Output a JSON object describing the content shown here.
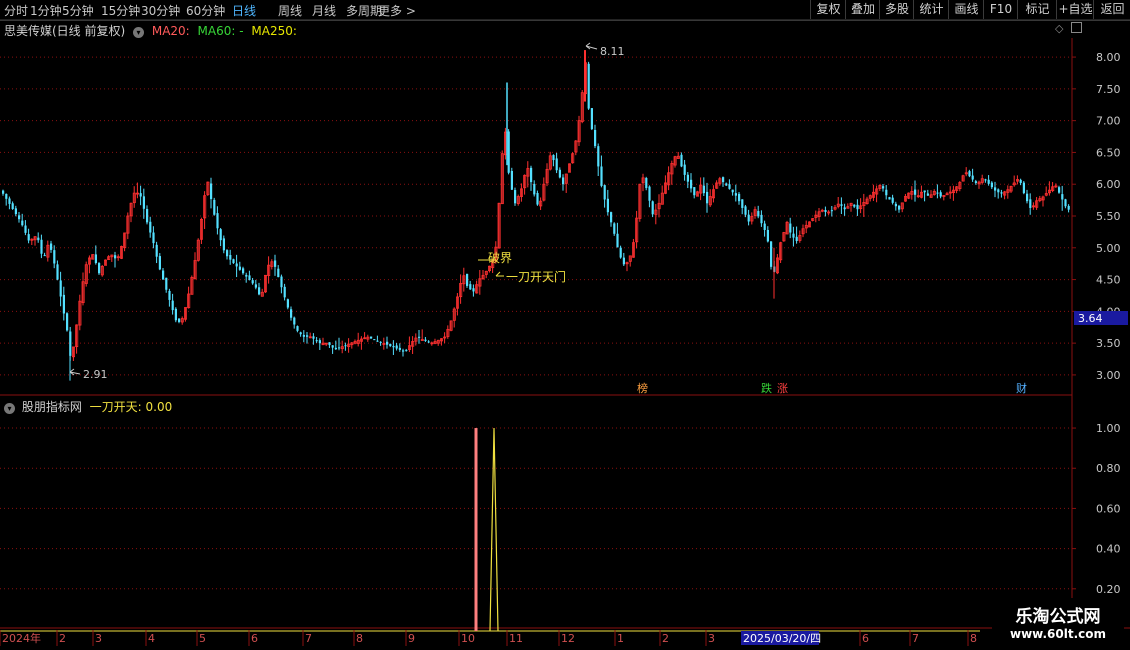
{
  "toolbar": {
    "periods": [
      "分时",
      "1分钟",
      "5分钟",
      "15分钟",
      "30分钟",
      "60分钟",
      "日线",
      "周线",
      "月线",
      "多周期",
      "更多 >"
    ],
    "active_period": "日线",
    "right_buttons": [
      "复权",
      "叠加",
      "多股",
      "统计",
      "画线",
      "F10",
      "标记",
      "+自选",
      "返回"
    ]
  },
  "main_header": {
    "stock": "思美传媒(日线 前复权)",
    "ma20": "MA20:",
    "ma60": "MA60: -",
    "ma250": "MA250:",
    "ma20_color": "#ff5a5a",
    "ma60_color": "#36d436",
    "ma250_color": "#e6e600"
  },
  "sub_header": {
    "name": "股朋指标网",
    "indicator": "一刀开天: 0.00",
    "indicator_color": "#f0e040"
  },
  "annotations": {
    "high_label": "8.11",
    "low_label": "2.91",
    "signal_label": "一刀开天门",
    "break_label": "破界",
    "price_tag": "3.64",
    "events": [
      "榜",
      "跌",
      "涨",
      "财"
    ]
  },
  "colors": {
    "up": "#ff3030",
    "down": "#54e0ff",
    "grid": "#8a1010"
  },
  "date_axis": {
    "year_label": "2024年",
    "months": [
      "2",
      "3",
      "4",
      "5",
      "6",
      "7",
      "8",
      "9",
      "10",
      "11",
      "12",
      "1",
      "2",
      "3",
      "6",
      "7",
      "8"
    ],
    "cursor_date": "2025/03/20/四"
  },
  "watermark": {
    "line1": "乐淘公式网",
    "line2": "www.60lt.com"
  },
  "chart_data": [
    {
      "type": "candlestick",
      "title": "思美传媒(日线 前复权)",
      "y_ticks": [
        3.0,
        3.5,
        4.0,
        4.5,
        5.0,
        5.5,
        6.0,
        6.5,
        7.0,
        7.5,
        8.0
      ],
      "ylim": [
        2.7,
        8.3
      ],
      "period": "2024-01 to 2025-08",
      "high": 8.11,
      "low": 2.91,
      "last_price": 3.64,
      "close_path": [
        [
          0,
          5.9
        ],
        [
          6,
          5.75
        ],
        [
          12,
          5.6
        ],
        [
          20,
          5.4
        ],
        [
          28,
          5.1
        ],
        [
          36,
          5.2
        ],
        [
          42,
          4.8
        ],
        [
          48,
          5.1
        ],
        [
          54,
          4.7
        ],
        [
          60,
          4.2
        ],
        [
          66,
          3.7
        ],
        [
          70,
          3.2
        ],
        [
          74,
          3.6
        ],
        [
          80,
          4.3
        ],
        [
          86,
          4.8
        ],
        [
          92,
          4.9
        ],
        [
          98,
          4.6
        ],
        [
          104,
          4.8
        ],
        [
          110,
          4.9
        ],
        [
          116,
          4.8
        ],
        [
          122,
          5.1
        ],
        [
          128,
          5.6
        ],
        [
          134,
          5.9
        ],
        [
          140,
          5.8
        ],
        [
          146,
          5.4
        ],
        [
          152,
          5.1
        ],
        [
          158,
          4.7
        ],
        [
          164,
          4.4
        ],
        [
          170,
          4.1
        ],
        [
          176,
          3.8
        ],
        [
          182,
          3.9
        ],
        [
          188,
          4.3
        ],
        [
          194,
          4.8
        ],
        [
          200,
          5.4
        ],
        [
          206,
          6.1
        ],
        [
          212,
          5.6
        ],
        [
          218,
          5.2
        ],
        [
          224,
          4.9
        ],
        [
          230,
          4.8
        ],
        [
          236,
          4.7
        ],
        [
          242,
          4.6
        ],
        [
          248,
          4.5
        ],
        [
          254,
          4.4
        ],
        [
          260,
          4.2
        ],
        [
          266,
          4.7
        ],
        [
          272,
          4.8
        ],
        [
          278,
          4.5
        ],
        [
          284,
          4.2
        ],
        [
          290,
          3.9
        ],
        [
          296,
          3.7
        ],
        [
          302,
          3.6
        ],
        [
          310,
          3.6
        ],
        [
          318,
          3.5
        ],
        [
          326,
          3.5
        ],
        [
          334,
          3.4
        ],
        [
          342,
          3.45
        ],
        [
          350,
          3.5
        ],
        [
          358,
          3.55
        ],
        [
          366,
          3.6
        ],
        [
          374,
          3.55
        ],
        [
          382,
          3.5
        ],
        [
          390,
          3.45
        ],
        [
          398,
          3.4
        ],
        [
          404,
          3.35
        ],
        [
          410,
          3.5
        ],
        [
          416,
          3.6
        ],
        [
          422,
          3.55
        ],
        [
          430,
          3.5
        ],
        [
          438,
          3.55
        ],
        [
          444,
          3.6
        ],
        [
          450,
          3.85
        ],
        [
          456,
          4.2
        ],
        [
          462,
          4.6
        ],
        [
          466,
          4.4
        ],
        [
          472,
          4.3
        ],
        [
          478,
          4.5
        ],
        [
          484,
          4.6
        ],
        [
          488,
          4.7
        ],
        [
          492,
          4.8
        ],
        [
          496,
          5.1
        ],
        [
          500,
          6.3
        ],
        [
          504,
          6.9
        ],
        [
          508,
          6.1
        ],
        [
          514,
          5.7
        ],
        [
          520,
          5.9
        ],
        [
          526,
          6.3
        ],
        [
          532,
          5.9
        ],
        [
          538,
          5.6
        ],
        [
          544,
          6.1
        ],
        [
          550,
          6.5
        ],
        [
          556,
          6.2
        ],
        [
          562,
          6.0
        ],
        [
          568,
          6.3
        ],
        [
          574,
          6.6
        ],
        [
          580,
          7.2
        ],
        [
          584,
          8.0
        ],
        [
          588,
          7.1
        ],
        [
          594,
          6.6
        ],
        [
          600,
          6.0
        ],
        [
          606,
          5.6
        ],
        [
          612,
          5.3
        ],
        [
          618,
          4.9
        ],
        [
          624,
          4.7
        ],
        [
          630,
          4.9
        ],
        [
          634,
          5.2
        ],
        [
          640,
          6.2
        ],
        [
          646,
          5.9
        ],
        [
          652,
          5.5
        ],
        [
          658,
          5.7
        ],
        [
          664,
          6.0
        ],
        [
          670,
          6.3
        ],
        [
          676,
          6.5
        ],
        [
          682,
          6.2
        ],
        [
          688,
          6.0
        ],
        [
          694,
          5.8
        ],
        [
          700,
          6.0
        ],
        [
          706,
          5.7
        ],
        [
          712,
          5.9
        ],
        [
          718,
          6.1
        ],
        [
          724,
          6.0
        ],
        [
          730,
          5.9
        ],
        [
          736,
          5.8
        ],
        [
          742,
          5.6
        ],
        [
          748,
          5.4
        ],
        [
          754,
          5.6
        ],
        [
          760,
          5.4
        ],
        [
          766,
          5.2
        ],
        [
          770,
          4.7
        ],
        [
          774,
          4.6
        ],
        [
          778,
          5.0
        ],
        [
          782,
          5.2
        ],
        [
          786,
          5.4
        ],
        [
          790,
          5.2
        ],
        [
          796,
          5.1
        ],
        [
          802,
          5.3
        ],
        [
          808,
          5.4
        ],
        [
          814,
          5.5
        ],
        [
          820,
          5.6
        ],
        [
          826,
          5.55
        ],
        [
          832,
          5.6
        ],
        [
          838,
          5.7
        ],
        [
          844,
          5.6
        ],
        [
          850,
          5.7
        ],
        [
          856,
          5.6
        ],
        [
          862,
          5.7
        ],
        [
          868,
          5.8
        ],
        [
          874,
          5.9
        ],
        [
          880,
          6.0
        ],
        [
          886,
          5.8
        ],
        [
          892,
          5.7
        ],
        [
          898,
          5.6
        ],
        [
          904,
          5.8
        ],
        [
          910,
          5.9
        ],
        [
          916,
          5.8
        ],
        [
          922,
          5.9
        ],
        [
          928,
          5.8
        ],
        [
          934,
          5.9
        ],
        [
          940,
          5.8
        ],
        [
          946,
          5.85
        ],
        [
          952,
          5.9
        ],
        [
          958,
          6.0
        ],
        [
          964,
          6.2
        ],
        [
          970,
          6.1
        ],
        [
          976,
          6.0
        ],
        [
          982,
          6.1
        ],
        [
          988,
          6.0
        ],
        [
          994,
          5.9
        ],
        [
          1000,
          5.85
        ],
        [
          1006,
          5.9
        ],
        [
          1012,
          6.0
        ],
        [
          1018,
          6.1
        ],
        [
          1024,
          5.8
        ],
        [
          1030,
          5.6
        ],
        [
          1036,
          5.75
        ],
        [
          1042,
          5.8
        ],
        [
          1048,
          5.9
        ],
        [
          1054,
          6.0
        ],
        [
          1060,
          5.8
        ],
        [
          1066,
          5.6
        ]
      ]
    },
    {
      "type": "line",
      "title": "一刀开天",
      "y_ticks": [
        0.2,
        0.4,
        0.6,
        0.8,
        1.0
      ],
      "ylim": [
        0,
        1.05
      ],
      "signals": [
        {
          "index_px": 476,
          "value": 1.0,
          "color": "#ff8080"
        },
        {
          "index_px": 494,
          "value": 1.0,
          "color": "#f0e040"
        }
      ]
    }
  ]
}
